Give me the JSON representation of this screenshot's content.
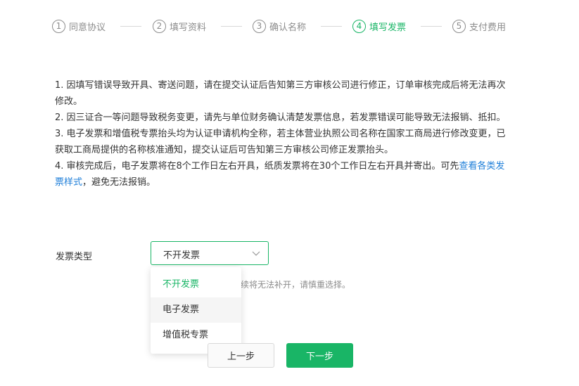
{
  "steps": [
    {
      "num": "1",
      "label": "同意协议"
    },
    {
      "num": "2",
      "label": "填写资料"
    },
    {
      "num": "3",
      "label": "确认名称"
    },
    {
      "num": "4",
      "label": "填写发票"
    },
    {
      "num": "5",
      "label": "支付费用"
    }
  ],
  "active_step": 4,
  "notice": {
    "p1": "1. 因填写错误导致开具、寄送问题，请在提交认证后告知第三方审核公司进行修正，订单审核完成后将无法再次修改。",
    "p2": "2. 因三证合一等问题导致税务变更，请先与单位财务确认清楚发票信息，若发票错误可能导致无法报销、抵扣。",
    "p3": "3. 电子发票和增值税专票抬头均为认证申请机构全称，若主体营业执照公司名称在国家工商局进行修改变更，已获取工商局提供的名称核准通知，提交认证后可告知第三方审核公司修正发票抬头。",
    "p4_before": "4. 审核完成后，电子发票将在8个工作日左右开具，纸质发票将在30个工作日左右开具并寄出。可先",
    "p4_link": "查看各类发票样式",
    "p4_after": "，避免无法报销。"
  },
  "invoice": {
    "label": "发票类型",
    "selected": "不开发票",
    "hint": "续将无法补开，请慎重选择。",
    "options": [
      "不开发票",
      "电子发票",
      "增值税专票"
    ]
  },
  "buttons": {
    "prev": "上一步",
    "next": "下一步"
  },
  "colors": {
    "accent": "#19b566",
    "link": "#1f7fd9",
    "muted": "#8c8c8c"
  }
}
